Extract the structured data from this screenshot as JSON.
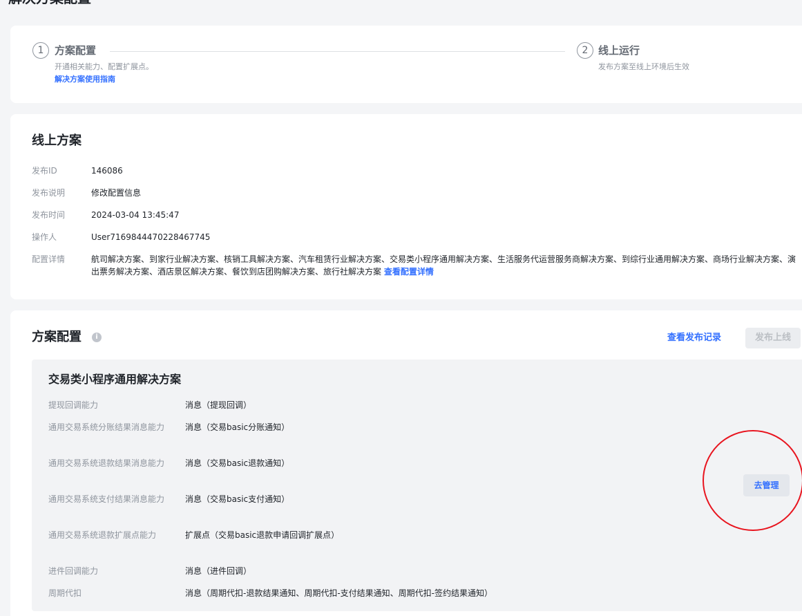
{
  "page": {
    "title": "解决方案配置"
  },
  "steps": [
    {
      "number": "1",
      "title": "方案配置",
      "desc": "开通相关能力、配置扩展点。",
      "link": "解决方案使用指南"
    },
    {
      "number": "2",
      "title": "线上运行",
      "desc": "发布方案至线上环境后生效"
    }
  ],
  "online": {
    "title": "线上方案",
    "fields": [
      {
        "label": "发布ID",
        "value": "146086"
      },
      {
        "label": "发布说明",
        "value": "修改配置信息"
      },
      {
        "label": "发布时间",
        "value": "2024-03-04 13:45:47"
      },
      {
        "label": "操作人",
        "value": "User7169844470228467745"
      },
      {
        "label": "配置详情",
        "value": "航司解决方案、到家行业解决方案、核销工具解决方案、汽车租赁行业解决方案、交易类小程序通用解决方案、生活服务代运营服务商解决方案、到综行业通用解决方案、商场行业解决方案、演出票务解决方案、酒店景区解决方案、餐饮到店团购解决方案、旅行社解决方案",
        "link": "查看配置详情"
      }
    ]
  },
  "config": {
    "title": "方案配置",
    "info_icon": "info-icon",
    "view_records": "查看发布记录",
    "publish": "发布上线",
    "solution": {
      "title": "交易类小程序通用解决方案",
      "manage": "去管理",
      "capabilities": [
        {
          "label": "提现回调能力",
          "value": "消息（提现回调）"
        },
        {
          "label": "通用交易系统分账结果消息能力",
          "value": "消息（交易basic分账通知）"
        },
        {
          "label": "通用交易系统退款结果消息能力",
          "value": "消息（交易basic退款通知）"
        },
        {
          "label": "通用交易系统支付结果消息能力",
          "value": "消息（交易basic支付通知）"
        },
        {
          "label": "通用交易系统退款扩展点能力",
          "value": "扩展点（交易basic退款申请回调扩展点）"
        },
        {
          "label": "进件回调能力",
          "value": "消息（进件回调）"
        },
        {
          "label": "周期代扣",
          "value": "消息（周期代扣-退款结果通知、周期代扣-支付结果通知、周期代扣-签约结果通知）"
        }
      ]
    }
  },
  "colors": {
    "accent": "#3370ff",
    "annotation": "#e8141e"
  }
}
